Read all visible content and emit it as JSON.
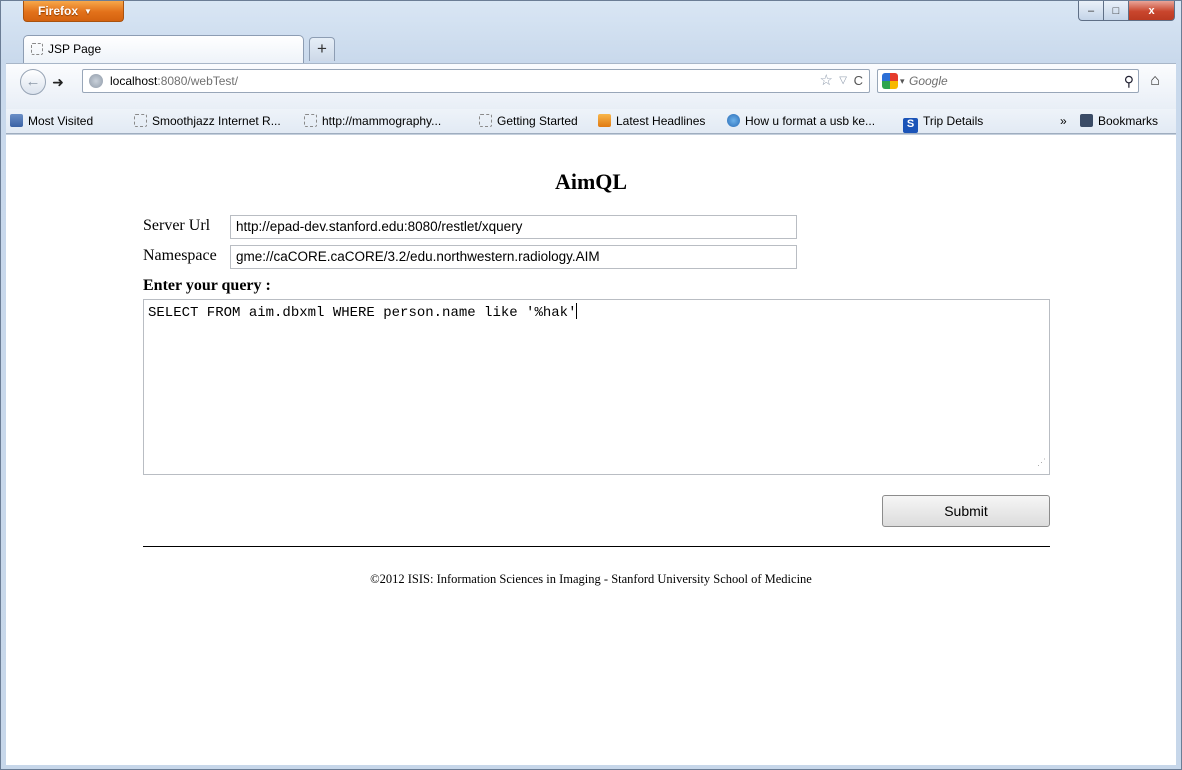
{
  "browser": {
    "menu_button": "Firefox",
    "window_controls": {
      "minimize": "–",
      "maximize": "□",
      "close": "x"
    },
    "tabs": [
      {
        "label": "JSP Page"
      }
    ],
    "new_tab": "+",
    "url": {
      "host": "localhost",
      "rest": ":8080/webTest/"
    },
    "search": {
      "placeholder": "Google"
    },
    "bookmarks": [
      {
        "label": "Most Visited",
        "icon": "most-visited-icon"
      },
      {
        "label": "Smoothjazz Internet R...",
        "icon": "page-icon"
      },
      {
        "label": "http://mammography...",
        "icon": "page-icon"
      },
      {
        "label": "Getting Started",
        "icon": "page-icon"
      },
      {
        "label": "Latest Headlines",
        "icon": "rss-icon"
      },
      {
        "label": "How u format a usb ke...",
        "icon": "hand-icon"
      },
      {
        "label": "Trip Details",
        "icon": "s-icon"
      }
    ],
    "bookmarks_menu": "Bookmarks",
    "overflow": "»"
  },
  "page": {
    "title": "AimQL",
    "server_url": {
      "label": "Server Url",
      "value": "http://epad-dev.stanford.edu:8080/restlet/xquery"
    },
    "namespace": {
      "label": "Namespace",
      "value": "gme://caCORE.caCORE/3.2/edu.northwestern.radiology.AIM"
    },
    "query": {
      "label": "Enter your query :",
      "value": "SELECT FROM aim.dbxml WHERE person.name like '%hak'"
    },
    "submit_label": "Submit",
    "footer": "©2012 ISIS: Information Sciences in Imaging - Stanford University School of Medicine"
  }
}
